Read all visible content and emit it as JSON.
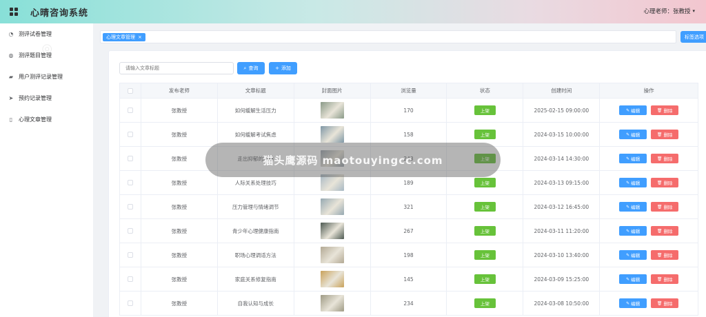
{
  "header": {
    "app_title": "心晴咨询系统",
    "user_label": "心理老师：张教授",
    "caret": "▾"
  },
  "sidebar": {
    "items": [
      {
        "icon": "clock-icon",
        "glyph": "◔",
        "label": "测评试卷管理"
      },
      {
        "icon": "globe-icon",
        "glyph": "◍",
        "label": "测评题目管理"
      },
      {
        "icon": "record-icon",
        "glyph": "▰",
        "label": "用户测评记录管理"
      },
      {
        "icon": "send-icon",
        "glyph": "➤",
        "label": "预约记录管理"
      },
      {
        "icon": "book-icon",
        "glyph": "▯",
        "label": "心理文章管理"
      }
    ]
  },
  "tags": {
    "active_tag": "心理文章管理",
    "close": "×",
    "select_button": "标签选项"
  },
  "toolbar": {
    "search_placeholder": "请输入文章标题",
    "search_button": "查询",
    "add_button": "添加"
  },
  "table": {
    "headers": [
      "",
      "发布老师",
      "文章标题",
      "封面图片",
      "浏览量",
      "状态",
      "创建时间",
      "操作"
    ],
    "status_label": "上架",
    "edit_label": "编辑",
    "delete_label": "删除",
    "rows": [
      {
        "teacher": "张教授",
        "title": "如何缓解生活压力",
        "views": "170",
        "created": "2025-02-15 09:00:00",
        "thumb": "#8a9a88"
      },
      {
        "teacher": "张教授",
        "title": "如何缓解考试焦虑",
        "views": "158",
        "created": "2024-03-15 10:00:00",
        "thumb": "#7f97a6"
      },
      {
        "teacher": "张教授",
        "title": "走出抑郁的阴霾",
        "views": "243",
        "created": "2024-03-14 14:30:00",
        "thumb": "#9aa3ad"
      },
      {
        "teacher": "张教授",
        "title": "人际关系处理技巧",
        "views": "189",
        "created": "2024-03-13 09:15:00",
        "thumb": "#a7b8c4"
      },
      {
        "teacher": "张教授",
        "title": "压力管理与情绪调节",
        "views": "321",
        "created": "2024-03-12 16:45:00",
        "thumb": "#96a9b2"
      },
      {
        "teacher": "张教授",
        "title": "青少年心理健康指南",
        "views": "267",
        "created": "2024-03-11 11:20:00",
        "thumb": "#4e5a52"
      },
      {
        "teacher": "张教授",
        "title": "职场心理调适方法",
        "views": "198",
        "created": "2024-03-10 13:40:00",
        "thumb": "#b3a994"
      },
      {
        "teacher": "张教授",
        "title": "家庭关系修复指南",
        "views": "145",
        "created": "2024-03-09 15:25:00",
        "thumb": "#c9a25a"
      },
      {
        "teacher": "张教授",
        "title": "自我认知与成长",
        "views": "234",
        "created": "2024-03-08 10:50:00",
        "thumb": "#9e9a84"
      }
    ]
  },
  "overlay": {
    "text": "猫头鹰源码 maotouyingcc.com"
  },
  "colors": {
    "primary": "#409eff",
    "success": "#67c23a",
    "danger": "#f56c6c"
  }
}
